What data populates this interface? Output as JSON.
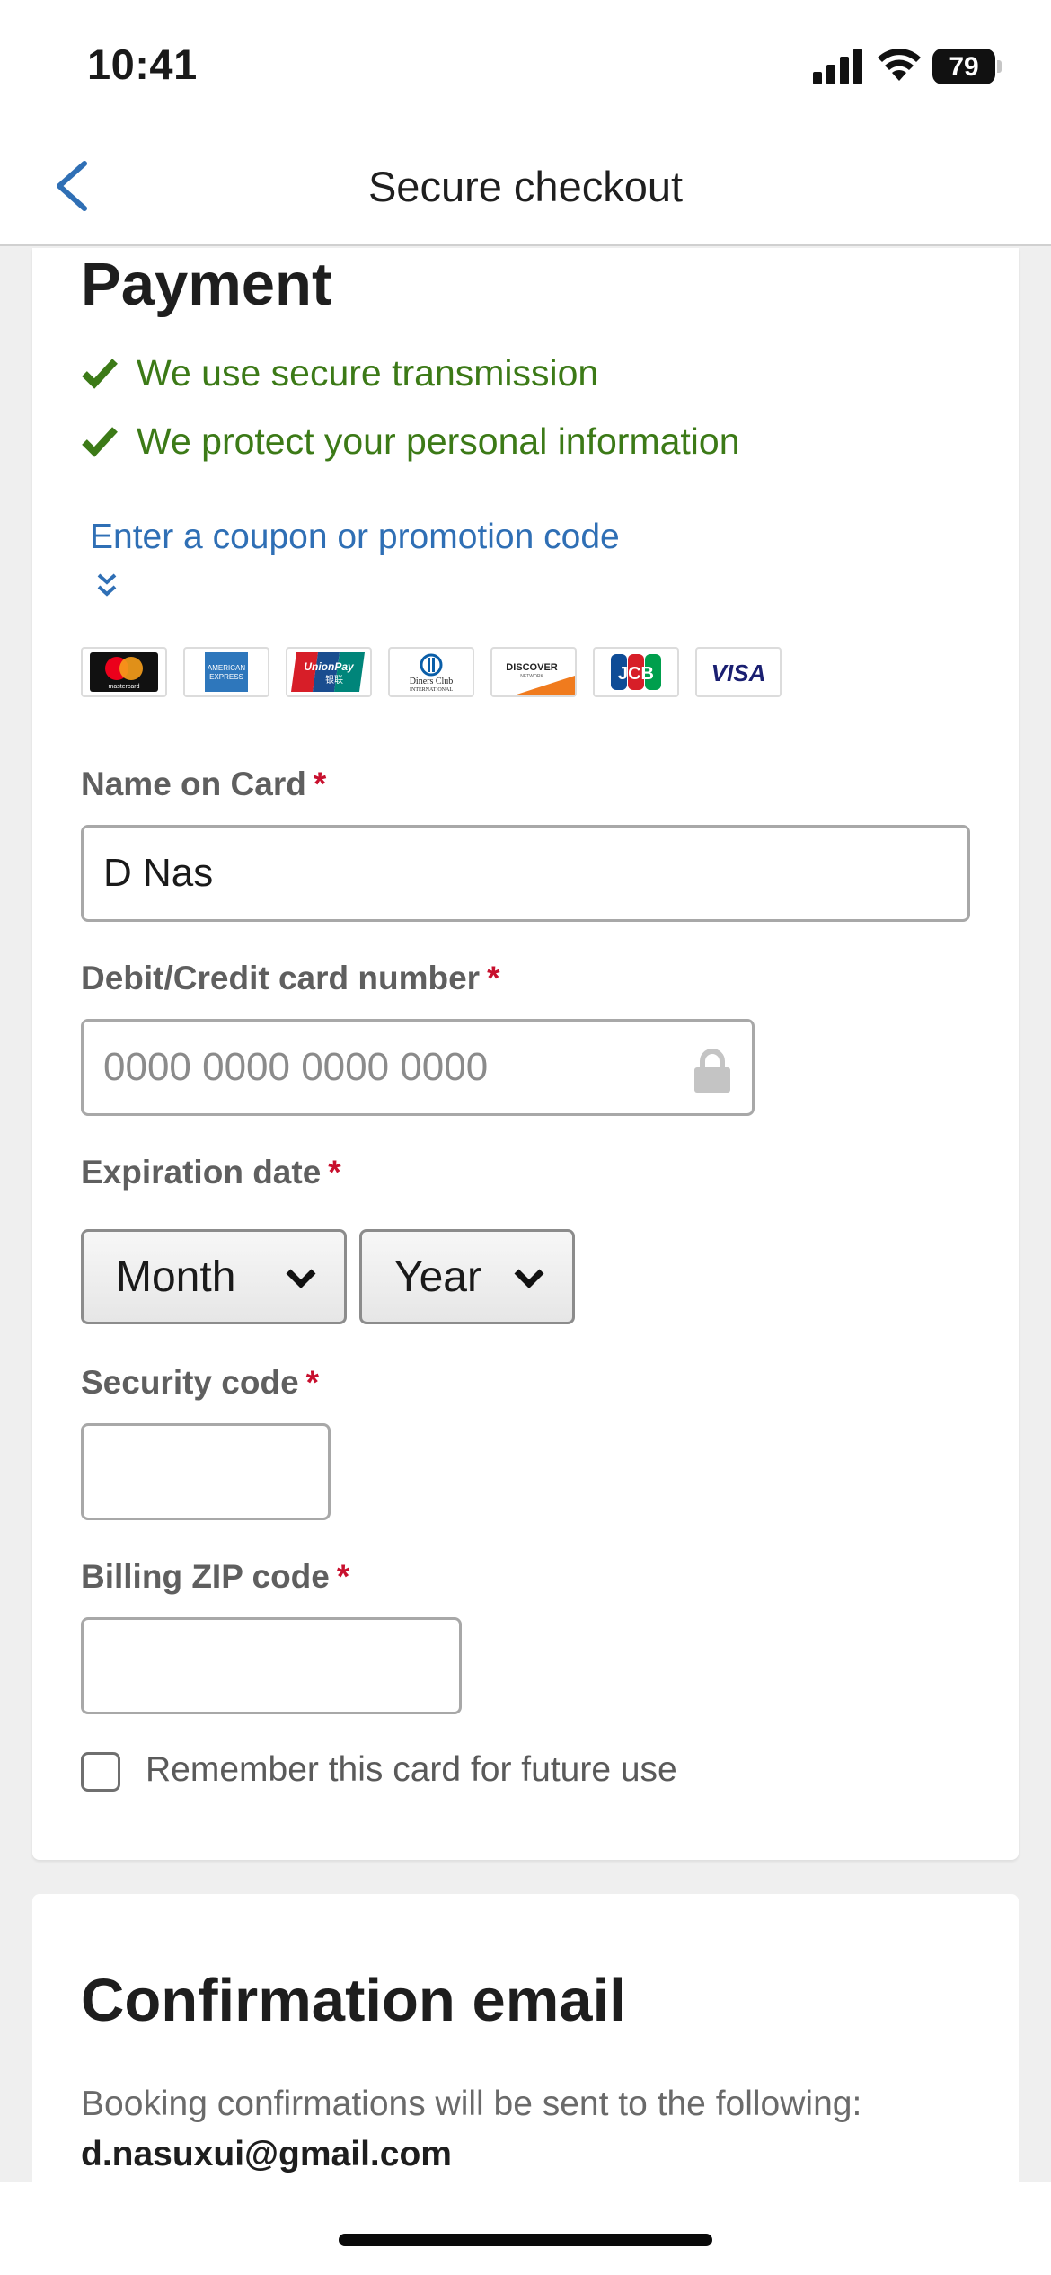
{
  "status_bar": {
    "time": "10:41",
    "battery": "79"
  },
  "nav": {
    "title": "Secure checkout"
  },
  "payment": {
    "title": "Payment",
    "assurances": [
      "We use secure transmission",
      "We protect your personal information"
    ],
    "coupon_link": "Enter a coupon or promotion code",
    "card_logos": [
      "mastercard",
      "American Express",
      "UnionPay",
      "Diners Club",
      "DISCOVER",
      "JCB",
      "VISA"
    ],
    "logo_text": {
      "mastercard": "mastercard",
      "amex_1": "AMERICAN",
      "amex_2": "EXPRESS",
      "unionpay": "UnionPay",
      "unionpay_cn": "银联",
      "diners_1": "Diners Club",
      "diners_2": "INTERNATIONAL",
      "discover": "DISCOVER",
      "discover_sub": "NETWORK",
      "jcb": "JCB",
      "visa": "VISA"
    },
    "name_label": "Name on Card",
    "name_value": "D Nas",
    "card_number_label": "Debit/Credit card number",
    "card_number_placeholder": "0000 0000 0000 0000",
    "expiration_label": "Expiration date",
    "month_value": "Month",
    "year_value": "Year",
    "security_label": "Security code",
    "zip_label": "Billing ZIP code",
    "remember_label": "Remember this card for future use",
    "required_mark": "*"
  },
  "confirmation": {
    "title": "Confirmation email",
    "text": "Booking confirmations will be sent to the following:",
    "email": "d.nasuxui@gmail.com"
  },
  "colors": {
    "accent": "#2f6fb5",
    "success": "#3c7a17",
    "required": "#c8102e"
  }
}
